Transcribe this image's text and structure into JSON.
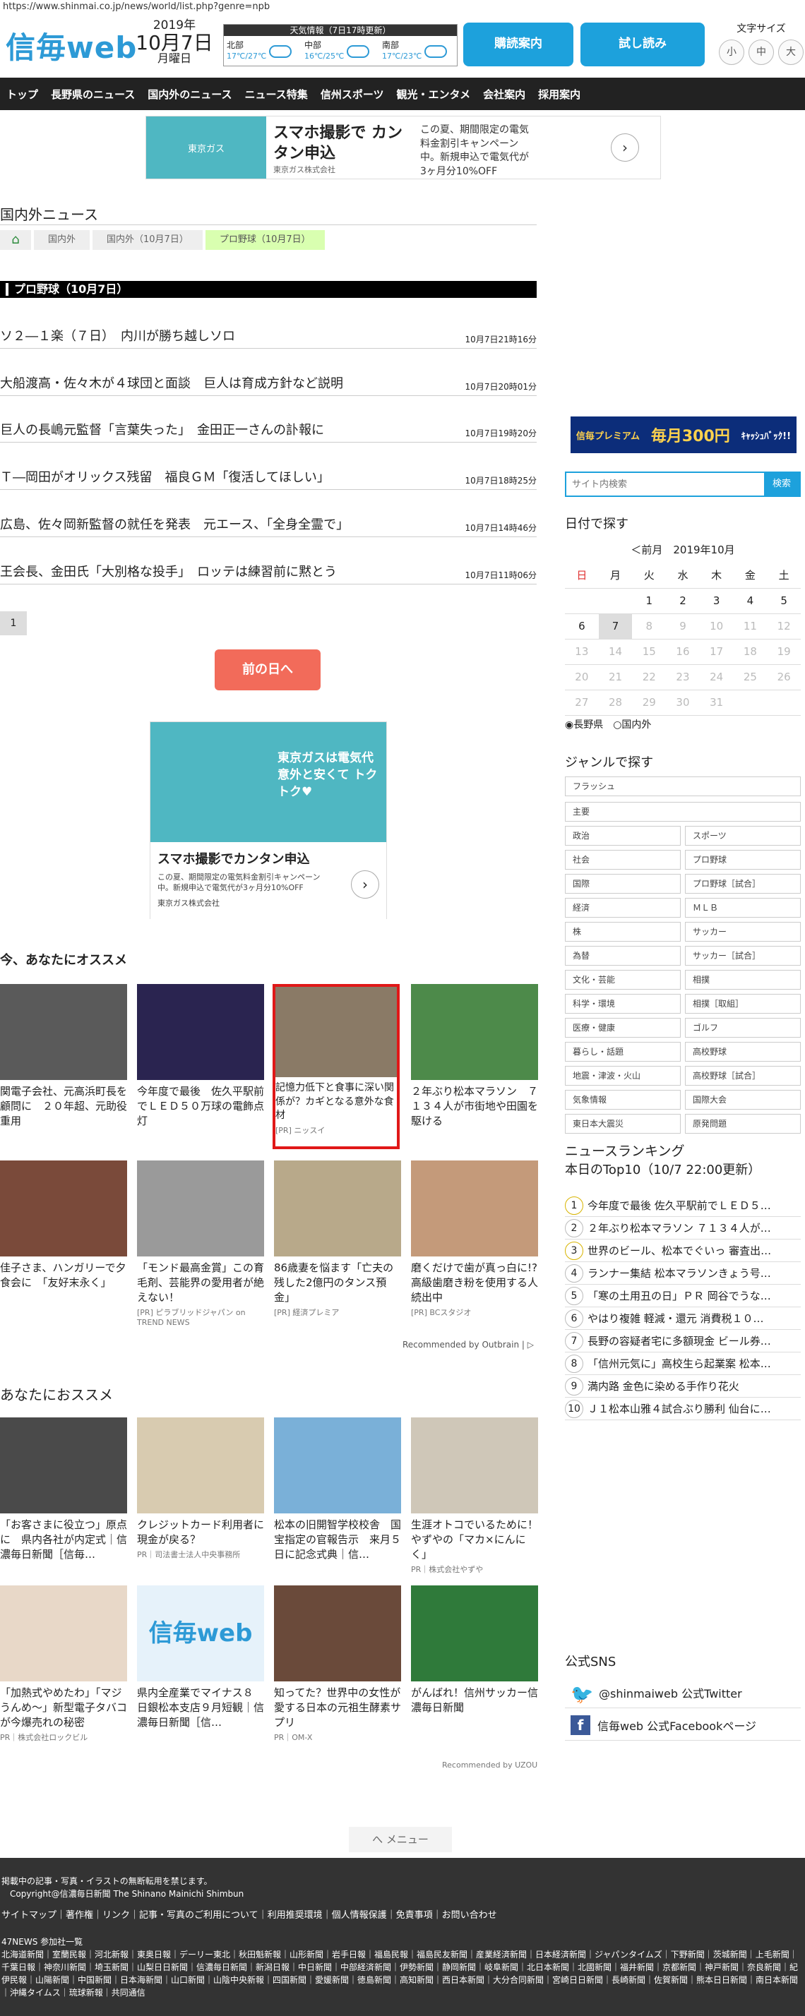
{
  "url": "https://www.shinmai.co.jp/news/world/list.php?genre=npb",
  "logo": "信毎web",
  "date": {
    "year": "2019年",
    "md": "10月7日",
    "weekday": "月曜日"
  },
  "weather": {
    "title": "天気情報（7日17時更新）",
    "cells": [
      {
        "area": "北部",
        "temp": "17℃/27℃",
        "rain": ""
      },
      {
        "area": "中部",
        "temp": "16℃/25℃",
        "rain": ""
      },
      {
        "area": "南部",
        "temp": "17℃/23℃",
        "rain": ""
      }
    ]
  },
  "header_buttons": {
    "subscribe": "購読案内",
    "trial": "試し読み"
  },
  "fontsize": {
    "label": "文字サイズ",
    "small": "小",
    "medium": "中",
    "large": "大"
  },
  "nav": [
    "トップ",
    "長野県のニュース",
    "国内外のニュース",
    "ニュース特集",
    "信州スポーツ",
    "観光・エンタメ",
    "会社案内",
    "採用案内"
  ],
  "ad_top": {
    "img_text": "東京ガス",
    "headline": "スマホ撮影で カンタン申込",
    "sponsor": "東京ガス株式会社",
    "body": "この夏、期間限定の電気料金割引キャンペーン中。新規申込で電気代が3ヶ月分10%OFF",
    "arrow": "›"
  },
  "section_title": "国内外ニュース",
  "breadcrumb": {
    "home": "⌂",
    "items": [
      "国内外",
      "国内外（10月7日）",
      "プロ野球（10月7日）"
    ]
  },
  "page_heading": "プロ野球（10月7日）",
  "news": [
    {
      "title": "ソ２―１楽（７日）　内川が勝ち越しソロ",
      "date": "10月7日21時16分"
    },
    {
      "title": "大船渡高・佐々木が４球団と面談　巨人は育成方針など説明",
      "date": "10月7日20時01分"
    },
    {
      "title": "巨人の長嶋元監督「言葉失った」　金田正一さんの訃報に",
      "date": "10月7日19時20分"
    },
    {
      "title": "Ｔ―岡田がオリックス残留　福良ＧＭ「復活してほしい」",
      "date": "10月7日18時25分"
    },
    {
      "title": "広島、佐々岡新監督の就任を発表　元エース、「全身全霊で」",
      "date": "10月7日14時46分"
    },
    {
      "title": "王会長、金田氏「大別格な投手」　ロッテは練習前に黙とう",
      "date": "10月7日11時06分"
    }
  ],
  "pagination": {
    "page": "1",
    "prev_day": "前の日へ"
  },
  "ad_box": {
    "top": "東京ガスは電気代 意外と安くて トクトク♥",
    "headline": "スマホ撮影でカンタン申込",
    "body": "この夏、期間限定の電気料金割引キャンペーン中。新規申込で電気代が3ヶ月分10%OFF",
    "sponsor": "東京ガス株式会社",
    "arrow": "›"
  },
  "recommend1": {
    "title": "今、あなたにオススメ",
    "cards": [
      {
        "caption": "関電子会社、元高浜町長を顧問に　２０年超、元助役重用",
        "sponsor": ""
      },
      {
        "caption": "今年度で最後　佐久平駅前でＬＥＤ５０万球の電飾点灯",
        "sponsor": ""
      },
      {
        "caption": "記憶力低下と食事に深い関係が？カギとなる意外な食材",
        "sponsor": "[PR] ニッスイ"
      },
      {
        "caption": "２年ぶり松本マラソン　７１３４人が市街地や田園を駆ける",
        "sponsor": ""
      },
      {
        "caption": "佳子さま、ハンガリーで夕食会に　「友好末永く」",
        "sponsor": ""
      },
      {
        "caption": "「モンド最高金賞」この育毛剤、芸能界の愛用者が絶えない！",
        "sponsor": "[PR] ピラブリッドジャパン on TREND NEWS"
      },
      {
        "caption": "86歳妻を悩ます「亡夫の残した2億円のタンス預金」",
        "sponsor": "[PR] 経済プレミア"
      },
      {
        "caption": "磨くだけで歯が真っ白に!?高級歯磨き粉を使用する人続出中",
        "sponsor": "[PR] BCスタジオ"
      }
    ],
    "outbrain": "Recommended by Outbrain | ▷"
  },
  "recommend2": {
    "title": "あなたにおススメ",
    "cards": [
      {
        "caption": "「お客さまに役立つ」原点に　県内各社が内定式｜信濃毎日新聞［信毎…",
        "sponsor": ""
      },
      {
        "caption": "クレジットカード利用者に現金が戻る？",
        "sponsor": "PR｜司法書士法人中央事務所"
      },
      {
        "caption": "松本の旧開智学校校舎　国宝指定の官報告示　来月５日に記念式典｜信…",
        "sponsor": ""
      },
      {
        "caption": "生涯オトコでいるために！やずやの「マカ×にんにく」",
        "sponsor": "PR｜株式会社やずや"
      },
      {
        "caption": "「加熱式やめたわ」「マジうんめ～」新型電子タバコが今爆売れの秘密",
        "sponsor": "PR｜株式会社ロックビル"
      },
      {
        "caption": "県内全産業でマイナス８　日銀松本支店９月短観｜信濃毎日新聞［信…",
        "sponsor": ""
      },
      {
        "caption": "知ってた？世界中の女性が愛する日本の元祖生酵素サプリ",
        "sponsor": "PR｜OM-X"
      },
      {
        "caption": "がんばれ！信州サッカー信濃毎日新聞",
        "sponsor": ""
      }
    ],
    "uzou": "Recommended by UZOU"
  },
  "menu": "へ メニュー",
  "sidebar": {
    "premium": {
      "left": "信毎プレミアム",
      "mid": "毎月300円",
      "right": "ｷｬｯｼｭﾊﾞｯｸ!!"
    },
    "search_placeholder": "サイト内検索",
    "search_button": "検索",
    "date_title": "日付で探す",
    "cal_header": "＜前月　2019年10月",
    "weekdays": [
      "日",
      "月",
      "火",
      "水",
      "木",
      "金",
      "土"
    ],
    "weeks": [
      [
        "",
        "",
        "1",
        "2",
        "3",
        "4",
        "5"
      ],
      [
        "6",
        "7",
        "8",
        "9",
        "10",
        "11",
        "12"
      ],
      [
        "13",
        "14",
        "15",
        "16",
        "17",
        "18",
        "19"
      ],
      [
        "20",
        "21",
        "22",
        "23",
        "24",
        "25",
        "26"
      ],
      [
        "27",
        "28",
        "29",
        "30",
        "31",
        "",
        ""
      ]
    ],
    "radio": "◉長野県　○国内外",
    "genre_title": "ジャンルで探す",
    "genre_full": [
      "フラッシュ",
      "主要"
    ],
    "genre_pairs": [
      [
        "政治",
        "スポーツ"
      ],
      [
        "社会",
        "プロ野球"
      ],
      [
        "国際",
        "プロ野球［試合］"
      ],
      [
        "経済",
        "ＭＬＢ"
      ],
      [
        "株",
        "サッカー"
      ],
      [
        "為替",
        "サッカー［試合］"
      ],
      [
        "文化・芸能",
        "相撲"
      ],
      [
        "科学・環境",
        "相撲［取組］"
      ],
      [
        "医療・健康",
        "ゴルフ"
      ],
      [
        "暮らし・話題",
        "高校野球"
      ],
      [
        "地震・津波・火山",
        "高校野球［試合］"
      ],
      [
        "気象情報",
        "国際大会"
      ],
      [
        "東日本大震災",
        "原発問題"
      ]
    ],
    "ranking_title": "ニュースランキング",
    "ranking_sub": "本日のTop10（10/7 22:00更新）",
    "ranking": [
      "今年度で最後 佐久平駅前でＬＥＤ５…",
      "２年ぶり松本マラソン ７１３４人が…",
      "世界のビール、松本でぐいっ 審査出…",
      "ランナー集結 松本マラソンきょう号…",
      "「寒の土用丑の日」ＰＲ 岡谷でうな…",
      "やはり複雑 軽減・還元 消費税１０…",
      "長野の容疑者宅に多額現金 ビール券…",
      "「信州元気に」高校生ら起業案 松本…",
      "満内路 金色に染める手作り花火",
      "Ｊ１松本山雅４試合ぶり勝利 仙台に…"
    ],
    "sns_title": "公式SNS",
    "twitter": "@shinmaiweb 公式Twitter",
    "facebook": "信毎web 公式Facebookページ"
  },
  "footer": {
    "notice": "掲載中の記事・写真・イラストの無断転用を禁じます。",
    "copyright": "Copyright@信濃毎日新聞 The Shinano Mainichi Shimbun",
    "links": "サイトマップ｜著作権｜リンク｜記事・写真のご利用について｜利用推奨環境｜個人情報保護｜免責事項｜お問い合わせ",
    "network_title": "47NEWS 参加社一覧",
    "papers": "北海道新聞｜室蘭民報｜河北新報｜東奥日報｜デーリー東北｜秋田魁新報｜山形新聞｜岩手日報｜福島民報｜福島民友新聞｜産業経済新聞｜日本経済新聞｜ジャパンタイムズ｜下野新聞｜茨城新聞｜上毛新聞｜千葉日報｜神奈川新聞｜埼玉新聞｜山梨日日新聞｜信濃毎日新聞｜新潟日報｜中日新聞｜中部経済新聞｜伊勢新聞｜静岡新聞｜岐阜新聞｜北日本新聞｜北國新聞｜福井新聞｜京都新聞｜神戸新聞｜奈良新聞｜紀伊民報｜山陽新聞｜中国新聞｜日本海新聞｜山口新聞｜山陰中央新報｜四国新聞｜愛媛新聞｜徳島新聞｜高知新聞｜西日本新聞｜大分合同新聞｜宮崎日日新聞｜長崎新聞｜佐賀新聞｜熊本日日新聞｜南日本新聞｜沖縄タイムス｜琉球新報｜共同通信"
  },
  "colors": {
    "accent": "#1da1dc",
    "nav_bg": "#222222",
    "prev_btn": "#f26b5a",
    "footer_bg": "#333333",
    "highlight_border": "#e01818"
  }
}
